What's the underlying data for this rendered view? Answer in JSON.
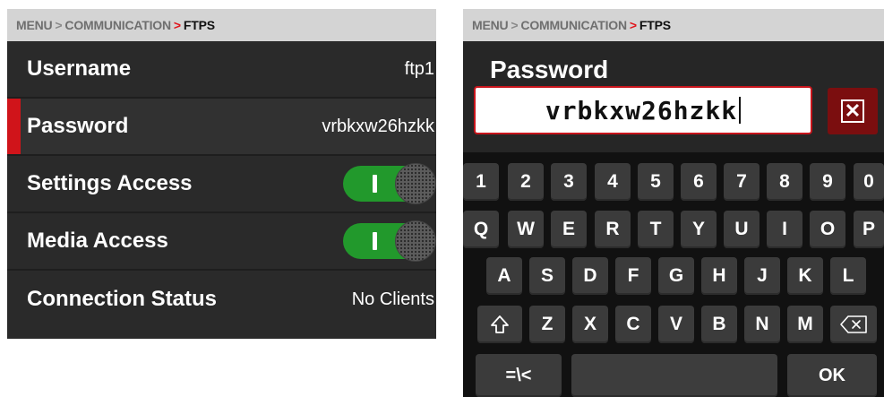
{
  "left_panel": {
    "breadcrumb": {
      "menu": "MENU",
      "sep": ">",
      "section": "COMMUNICATION",
      "arrow": ">",
      "current": "FTPS"
    },
    "rows": [
      {
        "label": "Username",
        "value": "ftp1"
      },
      {
        "label": "Password",
        "value": "vrbkxw26hzkk",
        "selected": true
      },
      {
        "label": "Settings Access",
        "toggle": "on"
      },
      {
        "label": "Media Access",
        "toggle": "on"
      },
      {
        "label": "Connection Status",
        "value": "No Clients"
      }
    ]
  },
  "right_panel": {
    "breadcrumb": {
      "menu": "MENU",
      "sep": ">",
      "section": "COMMUNICATION",
      "arrow": ">",
      "current": "FTPS"
    },
    "title": "Password",
    "input_value": "vrbkxw26hzkk",
    "clear_icon": "close-box-icon",
    "keyboard": {
      "row1": [
        "1",
        "2",
        "3",
        "4",
        "5",
        "6",
        "7",
        "8",
        "9",
        "0"
      ],
      "row2": [
        "Q",
        "W",
        "E",
        "R",
        "T",
        "Y",
        "U",
        "I",
        "O",
        "P"
      ],
      "row3": [
        "A",
        "S",
        "D",
        "F",
        "G",
        "H",
        "J",
        "K",
        "L"
      ],
      "row4": [
        "Z",
        "X",
        "C",
        "V",
        "B",
        "N",
        "M"
      ],
      "shift_icon": "shift-up-icon",
      "backspace_icon": "backspace-icon",
      "symbols_label": "=\\<",
      "ok_label": "OK"
    }
  },
  "colors": {
    "accent_red": "#d0141a",
    "toggle_green": "#22992c",
    "panel_bg": "#2a2a2a",
    "breadcrumb_bg": "#d4d4d4"
  }
}
